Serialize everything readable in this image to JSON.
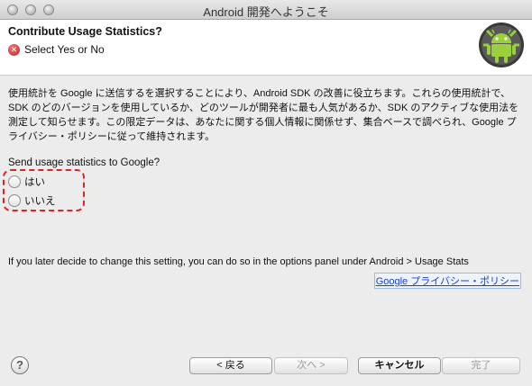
{
  "window": {
    "title": "Android 開発へようこそ"
  },
  "header": {
    "title": "Contribute Usage Statistics?",
    "message": "Select Yes or No",
    "logo_icon": "android-logo-icon",
    "error_icon": "error-icon"
  },
  "body": {
    "description_lines": [
      "使用統計を Google に送信するを選択することにより、Android SDK の改善に役立ちます。これらの使用統計で、",
      "SDK のどのバージョンを使用しているか、どのツールが開発者に最も人気があるか、SDK のアクティブな使用法を",
      "測定して知らせます。この限定データは、あなたに関する個人情報に関係せず、集合ベースで調べられ、Google プ",
      "ライバシー・ポリシーに従って維持されます。"
    ],
    "question": "Send usage statistics to Google?",
    "options": [
      {
        "label": "はい",
        "selected": false
      },
      {
        "label": "いいえ",
        "selected": false
      }
    ],
    "later_note": "If you later decide to change this setting, you can do so in the options panel under Android > Usage Stats",
    "privacy_link": "Google プライバシー・ポリシー"
  },
  "footer": {
    "help_icon": "help-icon",
    "back": "< 戻る",
    "next": "次へ >",
    "cancel": "キャンセル",
    "finish": "完了"
  },
  "colors": {
    "link": "#1b3fd1",
    "highlight": "#e02222",
    "error": "#c21d1d"
  }
}
